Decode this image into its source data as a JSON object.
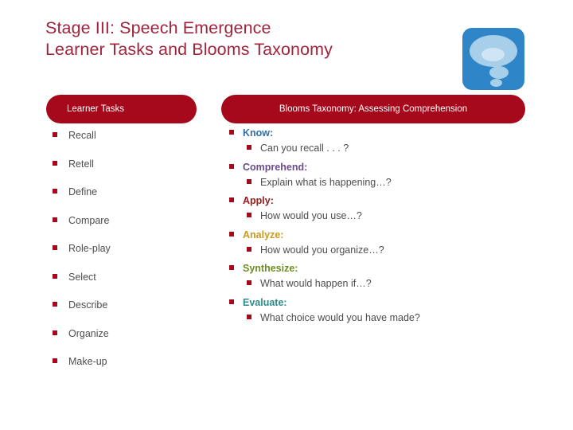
{
  "slide": {
    "title_lines": [
      "Stage III: Speech Emergence",
      "Learner Tasks and Blooms Taxonomy"
    ],
    "title_color": "#A0243C",
    "background_color": "#FFFFFF",
    "icon": {
      "name": "speech-bubble-icon",
      "background_color": "#2E86C8",
      "bubble_color": "#A8CFEA"
    }
  },
  "headers": {
    "left": {
      "label": "Learner Tasks",
      "background_color": "#A5091B",
      "text_color": "#FFFFFF"
    },
    "right": {
      "label": "Blooms Taxonomy: Assessing Comprehension",
      "background_color": "#A5091B",
      "text_color": "#FFFFFF"
    }
  },
  "learner_tasks": {
    "bullet_color": "#A5091B",
    "text_color": "#4D4D4D",
    "items": [
      {
        "label": "Recall"
      },
      {
        "label": "Retell"
      },
      {
        "label": "Define"
      },
      {
        "label": "Compare"
      },
      {
        "label": "Role-play"
      },
      {
        "label": "Select"
      },
      {
        "label": "Describe"
      },
      {
        "label": "Organize"
      },
      {
        "label": "Make-up"
      }
    ]
  },
  "blooms_taxonomy": {
    "bullet_color": "#A5091B",
    "question_text_color": "#4D4D4D",
    "levels": [
      {
        "label": "Know:",
        "color": "#2F6FA8",
        "question": "Can you recall . . . ?"
      },
      {
        "label": "Comprehend:",
        "color": "#6B4C8A",
        "question": "Explain what is happening…?"
      },
      {
        "label": "Apply:",
        "color": "#9B1B1B",
        "question": "How would you use…?"
      },
      {
        "label": "Analyze:",
        "color": "#C99A20",
        "question": "How would you organize…?"
      },
      {
        "label": "Synthesize:",
        "color": "#6B8E23",
        "question": "What would happen if…?"
      },
      {
        "label": "Evaluate:",
        "color": "#2E8B8B",
        "question": "What choice would you have made?"
      }
    ]
  }
}
